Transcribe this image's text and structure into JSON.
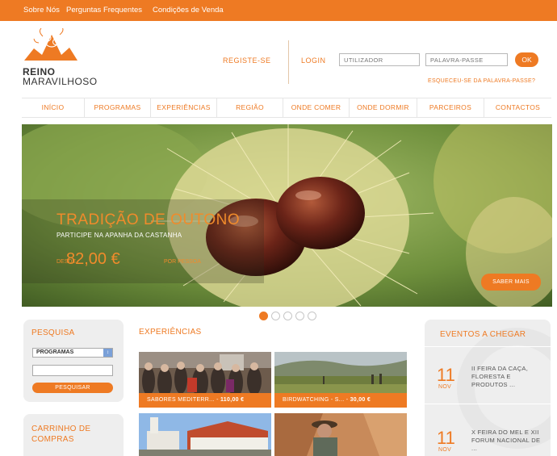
{
  "topbar": {
    "links": [
      "Sobre Nós",
      "Perguntas Frequentes",
      "Condições de Venda"
    ]
  },
  "brand": {
    "line1": "REINO",
    "line2": "MARAVILHOSO"
  },
  "account": {
    "register": "REGISTE-SE",
    "login": "LOGIN",
    "user_placeholder": "UTILIZADOR",
    "pass_placeholder": "PALAVRA-PASSE",
    "ok": "OK",
    "forgot": "ESQUECEU-SE DA PALAVRA-PASSE?"
  },
  "nav": {
    "items": [
      "INÍCIO",
      "PROGRAMAS",
      "EXPERIÊNCIAS",
      "REGIÃO",
      "ONDE COMER",
      "ONDE DORMIR",
      "PARCEIROS",
      "CONTACTOS"
    ]
  },
  "hero": {
    "title": "TRADIÇÃO DE OUTONO",
    "subtitle": "PARTICIPE NA APANHA DA CASTANHA",
    "price_prefix": "DESDE",
    "price": "82,00 €",
    "price_suffix": "POR PESSOA",
    "cta": "SABER MAIS",
    "slides": 5,
    "active_slide": 1
  },
  "search": {
    "title": "PESQUISA",
    "select_value": "PROGRAMAS",
    "button": "PESQUISAR"
  },
  "cart": {
    "title": "CARRINHO DE COMPRAS"
  },
  "experiences": {
    "title": "EXPERIÊNCIAS",
    "tiles": [
      {
        "caption": "SABORES MEDITERR... - ",
        "price": "110,00 €"
      },
      {
        "caption": "BIRDWATCHING - S... - ",
        "price": "30,00 €"
      },
      {
        "caption": "",
        "price": ""
      },
      {
        "caption": "",
        "price": ""
      }
    ]
  },
  "events": {
    "title": "EVENTOS A CHEGAR",
    "items": [
      {
        "day": "11",
        "month": "NOV",
        "name": "II FEIRA DA CAÇA, FLORESTA E PRODUTOS ..."
      },
      {
        "day": "11",
        "month": "NOV",
        "name": "X FEIRA DO MEL E XII FORUM NACIONAL DE ..."
      }
    ]
  },
  "colors": {
    "accent": "#ee7a23",
    "panel": "#eeeeee"
  }
}
